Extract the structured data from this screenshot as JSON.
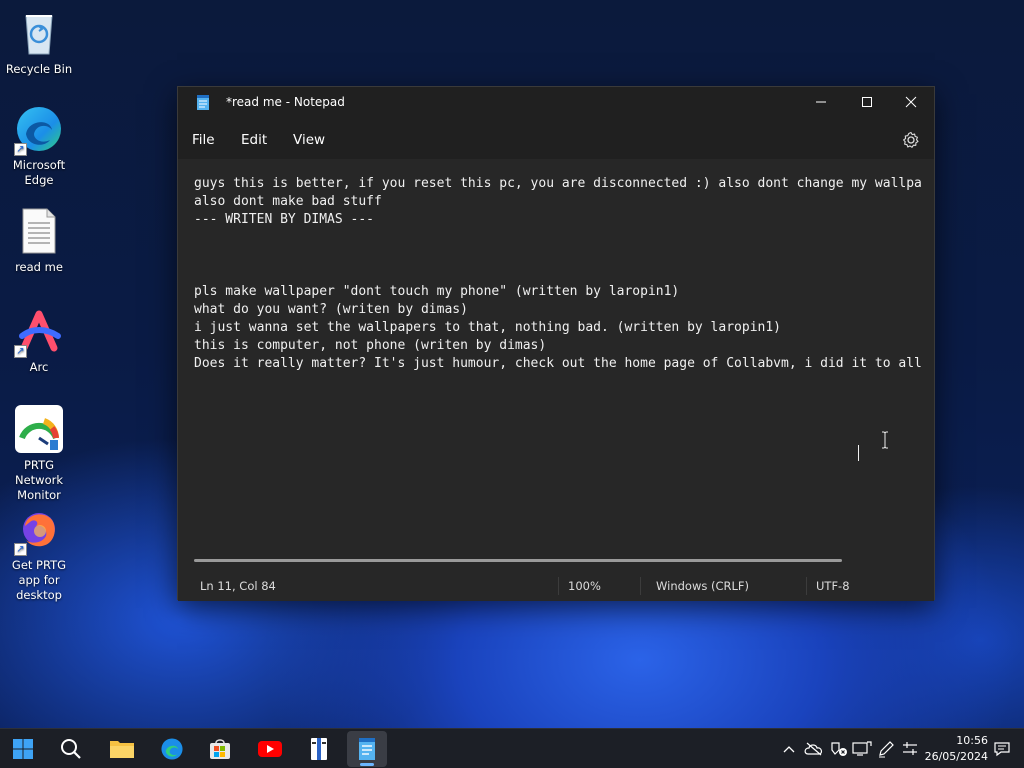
{
  "desktop": {
    "icons": [
      {
        "label": "Recycle Bin",
        "icon": "recycle-bin-icon"
      },
      {
        "label": "Microsoft Edge",
        "icon": "edge-icon"
      },
      {
        "label": "read me",
        "icon": "text-file-icon"
      },
      {
        "label": "Arc",
        "icon": "arc-icon"
      },
      {
        "label": "PRTG Network Monitor",
        "icon": "prtg-icon"
      },
      {
        "label": "Get PRTG app for desktop",
        "icon": "firefox-icon"
      }
    ]
  },
  "notepad": {
    "title": "*read me - Notepad",
    "menu": {
      "file": "File",
      "edit": "Edit",
      "view": "View"
    },
    "lines": [
      "guys this is better, if you reset this pc, you are disconnected :) also dont change my wallpa",
      "also dont make bad stuff",
      "--- WRITEN BY DIMAS ---",
      "",
      "",
      "",
      "pls make wallpaper \"dont touch my phone\" (written by laropin1)",
      "what do you want? (writen by dimas)",
      "i just wanna set the wallpapers to that, nothing bad. (written by laropin1)",
      "this is computer, not phone (writen by dimas)",
      "Does it really matter? It's just humour, check out the home page of Collabvm, i did it to all"
    ],
    "status": {
      "position": "Ln 11, Col 84",
      "zoom": "100%",
      "line_ending": "Windows (CRLF)",
      "encoding": "UTF-8"
    }
  },
  "taskbar": {
    "clock_time": "10:56",
    "clock_date": "26/05/2024"
  },
  "colors": {
    "accent": "#6cb6ff",
    "window_bg": "#202020",
    "editor_bg": "#272727"
  }
}
